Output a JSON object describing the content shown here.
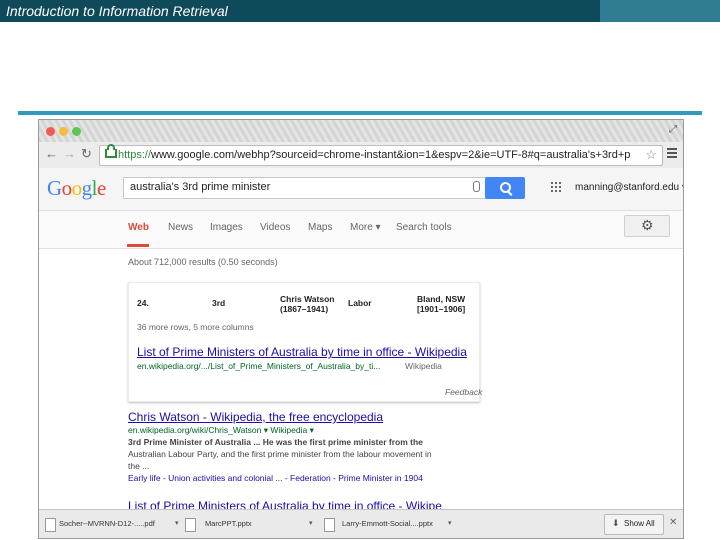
{
  "slide": {
    "title": "Introduction to Information Retrieval"
  },
  "browser": {
    "url_scheme": "https://",
    "url_rest": "www.google.com/webhp?sourceid=chrome-instant&ion=1&espv=2&ie=UTF-8#q=australia's+3rd+prime..."
  },
  "google": {
    "logo_letters": [
      "G",
      "o",
      "o",
      "g",
      "l",
      "e"
    ],
    "logo_colors": [
      "#4285f4",
      "#ea4335",
      "#fbbc05",
      "#4285f4",
      "#34a853",
      "#ea4335"
    ],
    "query": "australia's 3rd prime minister",
    "account": "manning@stanford.edu ▾",
    "tabs": [
      "Web",
      "News",
      "Images",
      "Videos",
      "Maps",
      "More ▾",
      "Search tools"
    ],
    "result_stats": "About 712,000 results (0.50 seconds)"
  },
  "answer_card": {
    "row": [
      "24.",
      "3rd",
      "Chris Watson",
      "(1867–1941)",
      "Labor",
      "Bland, NSW",
      "[1901–1906]"
    ],
    "more_rows": "36 more rows, 5 more columns",
    "link_title": "List of Prime Ministers of Australia by time in office - Wikipedia",
    "url": "en.wikipedia.org/.../List_of_Prime_Ministers_of_Australia_by_ti...",
    "source": "Wikipedia",
    "feedback": "Feedback"
  },
  "results": [
    {
      "title": "Chris Watson - Wikipedia, the free encyclopedia",
      "url": "en.wikipedia.org/wiki/Chris_Watson ▾  Wikipedia ▾",
      "snippet": [
        "3rd Prime Minister of Australia ... He was the first prime minister from the",
        "Australian Labour Party, and the first prime minister from the labour movement in",
        "the ...",
        "Early life - Union activities and colonial ... - Federation - Prime Minister in 1904"
      ]
    },
    {
      "title": "List of Prime Ministers of Australia by time in office - Wikipe"
    }
  ],
  "downloads": {
    "items": [
      "Socher--MVRNN-D12-.....pdf",
      "MarcPPT.pptx",
      "Larry-Emmott-Social....pptx"
    ],
    "show_all": "Show All"
  },
  "colors": {
    "header_bar": "#0f4a5a",
    "accent_rule": "#2e9cbc",
    "link": "#1a0dab",
    "url_green": "#006621",
    "active_tab": "#dd4b39",
    "search_blue": "#4285f4"
  }
}
